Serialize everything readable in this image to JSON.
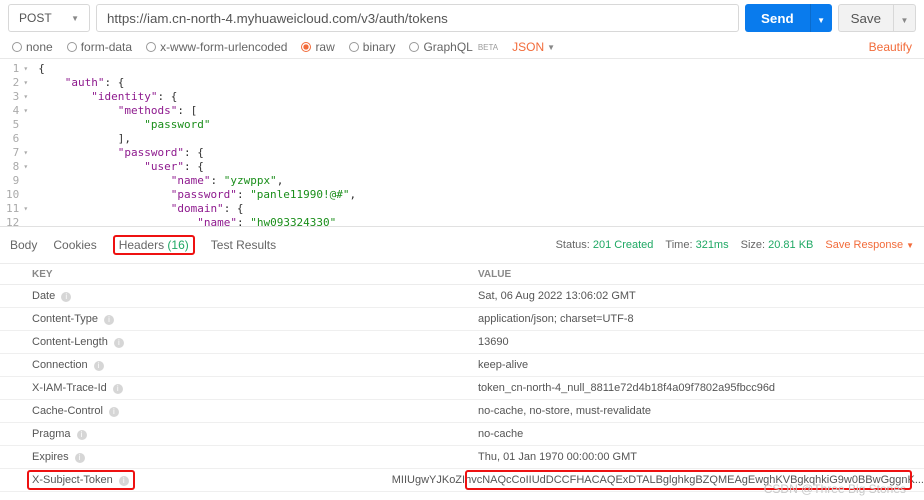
{
  "req": {
    "method": "POST",
    "url": "https://iam.cn-north-4.myhuaweicloud.com/v3/auth/tokens",
    "send": "Send",
    "save": "Save"
  },
  "body_types": {
    "none": "none",
    "form": "form-data",
    "xwww": "x-www-form-urlencoded",
    "raw": "raw",
    "binary": "binary",
    "graphql": "GraphQL",
    "beta": "BETA",
    "json": "JSON",
    "beautify": "Beautify"
  },
  "code": [
    "{",
    "    \"auth\": {",
    "        \"identity\": {",
    "            \"methods\": [",
    "                \"password\"",
    "            ],",
    "            \"password\": {",
    "                \"user\": {",
    "                    \"name\": \"yzwppx\",",
    "                    \"password\": \"panle11990!@#\",",
    "                    \"domain\": {",
    "                        \"name\": \"hw093324330\"",
    "                    }",
    "                }",
    "            }"
  ],
  "tabs": {
    "body": "Body",
    "cookies": "Cookies",
    "headers": "Headers",
    "hcount": "(16)",
    "tests": "Test Results"
  },
  "status": {
    "slabel": "Status:",
    "sval": "201 Created",
    "tlabel": "Time:",
    "tval": "321ms",
    "zlabel": "Size:",
    "zval": "20.81 KB",
    "save": "Save Response"
  },
  "cols": {
    "key": "KEY",
    "value": "VALUE"
  },
  "headers": [
    {
      "k": "Date",
      "v": "Sat, 06 Aug 2022 13:06:02 GMT"
    },
    {
      "k": "Content-Type",
      "v": "application/json; charset=UTF-8"
    },
    {
      "k": "Content-Length",
      "v": "13690"
    },
    {
      "k": "Connection",
      "v": "keep-alive"
    },
    {
      "k": "X-IAM-Trace-Id",
      "v": "token_cn-north-4_null_8811e72d4b18f4a09f7802a95fbcc96d"
    },
    {
      "k": "Cache-Control",
      "v": "no-cache, no-store, must-revalidate"
    },
    {
      "k": "Pragma",
      "v": "no-cache"
    },
    {
      "k": "Expires",
      "v": "Thu, 01 Jan 1970 00:00:00 GMT"
    },
    {
      "k": "X-Subject-Token",
      "v": "MIIUgwYJKoZIhvcNAQcCoIIUdDCCFHACAQExDTALBglghkgBZQMEAgEwghKVBgkqhkiG9w0BBwGggnK..."
    }
  ],
  "watermark": "CSDN @Three Big Stones"
}
